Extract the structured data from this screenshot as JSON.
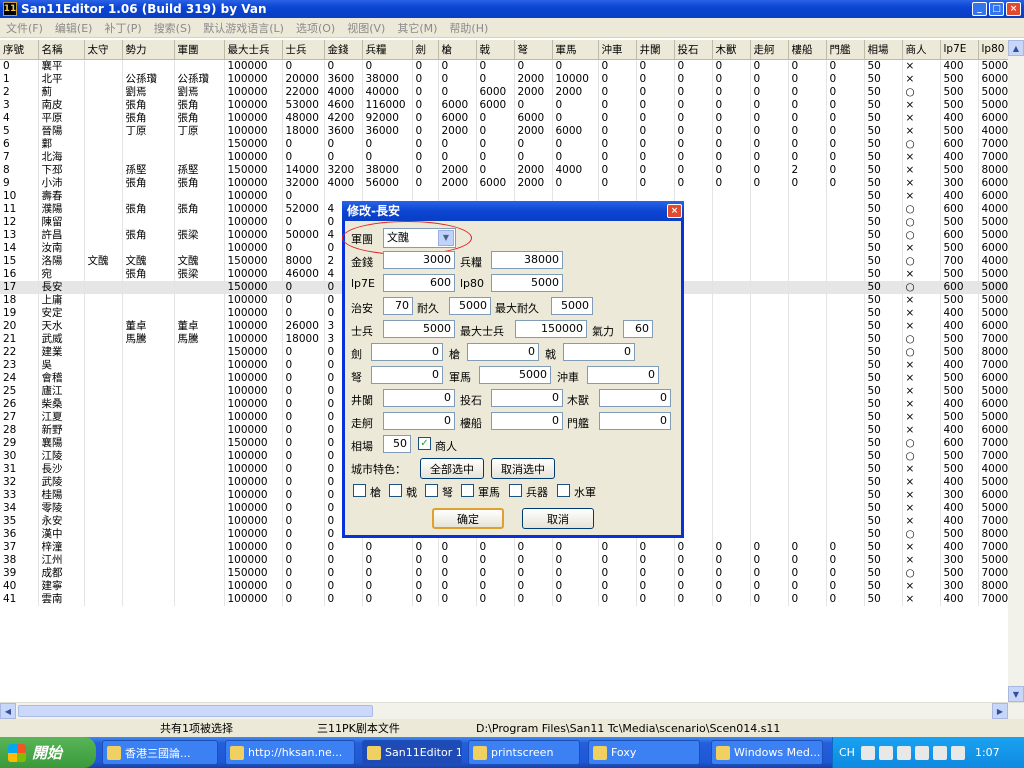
{
  "window": {
    "title": "San11Editor 1.06 (Build 319) by Van",
    "app_icon": "11",
    "min": "_",
    "max": "□",
    "close": "×"
  },
  "menu": [
    "文件(F)",
    "编辑(E)",
    "补丁(P)",
    "搜索(S)",
    "默认游戏语言(L)",
    "选项(O)",
    "视图(V)",
    "其它(M)",
    "帮助(H)"
  ],
  "table": {
    "columns": [
      "序號",
      "名稱",
      "太守",
      "勢力",
      "軍團",
      "最大士兵",
      "士兵",
      "金錢",
      "兵糧",
      "劍",
      "槍",
      "戟",
      "弩",
      "軍馬",
      "沖車",
      "井闌",
      "投石",
      "木獸",
      "走舸",
      "樓船",
      "門艦",
      "相場",
      "商人",
      "lp7E",
      "lp80"
    ],
    "selected_row": 17,
    "rows": [
      [
        "0",
        "襄平",
        "",
        "",
        "",
        "100000",
        "0",
        "0",
        "0",
        "0",
        "0",
        "0",
        "0",
        "0",
        "0",
        "0",
        "0",
        "0",
        "0",
        "0",
        "0",
        "50",
        "×",
        "400",
        "5000"
      ],
      [
        "1",
        "北平",
        "",
        "公孫瓚",
        "公孫瓚",
        "100000",
        "20000",
        "3600",
        "38000",
        "0",
        "0",
        "0",
        "2000",
        "10000",
        "0",
        "0",
        "0",
        "0",
        "0",
        "0",
        "0",
        "50",
        "×",
        "500",
        "6000"
      ],
      [
        "2",
        "薊",
        "",
        "劉焉",
        "劉焉",
        "100000",
        "22000",
        "4000",
        "40000",
        "0",
        "0",
        "6000",
        "2000",
        "2000",
        "0",
        "0",
        "0",
        "0",
        "0",
        "0",
        "0",
        "50",
        "○",
        "500",
        "5000"
      ],
      [
        "3",
        "南皮",
        "",
        "張角",
        "張角",
        "100000",
        "53000",
        "4600",
        "116000",
        "0",
        "6000",
        "6000",
        "0",
        "0",
        "0",
        "0",
        "0",
        "0",
        "0",
        "0",
        "0",
        "50",
        "×",
        "500",
        "5000"
      ],
      [
        "4",
        "平原",
        "",
        "張角",
        "張角",
        "100000",
        "48000",
        "4200",
        "92000",
        "0",
        "6000",
        "0",
        "6000",
        "0",
        "0",
        "0",
        "0",
        "0",
        "0",
        "0",
        "0",
        "50",
        "×",
        "400",
        "6000"
      ],
      [
        "5",
        "晉陽",
        "",
        "丁原",
        "丁原",
        "100000",
        "18000",
        "3600",
        "36000",
        "0",
        "2000",
        "0",
        "2000",
        "6000",
        "0",
        "0",
        "0",
        "0",
        "0",
        "0",
        "0",
        "50",
        "×",
        "500",
        "4000"
      ],
      [
        "6",
        "鄴",
        "",
        "",
        "",
        "150000",
        "0",
        "0",
        "0",
        "0",
        "0",
        "0",
        "0",
        "0",
        "0",
        "0",
        "0",
        "0",
        "0",
        "0",
        "0",
        "50",
        "○",
        "600",
        "7000"
      ],
      [
        "7",
        "北海",
        "",
        "",
        "",
        "100000",
        "0",
        "0",
        "0",
        "0",
        "0",
        "0",
        "0",
        "0",
        "0",
        "0",
        "0",
        "0",
        "0",
        "0",
        "0",
        "50",
        "×",
        "400",
        "7000"
      ],
      [
        "8",
        "下邳",
        "",
        "孫堅",
        "孫堅",
        "150000",
        "14000",
        "3200",
        "38000",
        "0",
        "2000",
        "0",
        "2000",
        "4000",
        "0",
        "0",
        "0",
        "0",
        "0",
        "2",
        "0",
        "50",
        "×",
        "500",
        "8000"
      ],
      [
        "9",
        "小沛",
        "",
        "張角",
        "張角",
        "100000",
        "32000",
        "4000",
        "56000",
        "0",
        "2000",
        "6000",
        "2000",
        "0",
        "0",
        "0",
        "0",
        "0",
        "0",
        "0",
        "0",
        "50",
        "×",
        "300",
        "6000"
      ],
      [
        "10",
        "壽春",
        "",
        "",
        "",
        "100000",
        "0",
        "",
        "",
        "",
        "",
        "",
        "",
        "",
        "",
        "",
        "",
        "",
        "",
        "",
        "",
        "50",
        "×",
        "400",
        "6000"
      ],
      [
        "11",
        "濮陽",
        "",
        "張角",
        "張角",
        "100000",
        "52000",
        "4",
        "",
        "",
        "",
        "",
        "",
        "",
        "",
        "",
        "",
        "",
        "",
        "",
        "",
        "50",
        "○",
        "600",
        "4000"
      ],
      [
        "12",
        "陳留",
        "",
        "",
        "",
        "100000",
        "0",
        "0",
        "",
        "",
        "",
        "",
        "",
        "",
        "",
        "",
        "",
        "",
        "",
        "",
        "",
        "50",
        "○",
        "500",
        "5000"
      ],
      [
        "13",
        "許昌",
        "",
        "張角",
        "張梁",
        "100000",
        "50000",
        "4",
        "",
        "",
        "",
        "",
        "",
        "",
        "",
        "",
        "",
        "",
        "",
        "",
        "",
        "50",
        "○",
        "600",
        "5000"
      ],
      [
        "14",
        "汝南",
        "",
        "",
        "",
        "100000",
        "0",
        "0",
        "",
        "",
        "",
        "",
        "",
        "",
        "",
        "",
        "",
        "",
        "",
        "",
        "",
        "50",
        "×",
        "500",
        "6000"
      ],
      [
        "15",
        "洛陽",
        "文醜",
        "文醜",
        "文醜",
        "150000",
        "8000",
        "2",
        "",
        "",
        "",
        "",
        "",
        "",
        "",
        "",
        "",
        "",
        "",
        "",
        "",
        "50",
        "○",
        "700",
        "4000"
      ],
      [
        "16",
        "宛",
        "",
        "張角",
        "張梁",
        "100000",
        "46000",
        "4",
        "",
        "",
        "",
        "",
        "",
        "",
        "",
        "",
        "",
        "",
        "",
        "",
        "",
        "50",
        "×",
        "500",
        "5000"
      ],
      [
        "17",
        "長安",
        "",
        "",
        "",
        "150000",
        "0",
        "0",
        "",
        "",
        "",
        "",
        "",
        "",
        "",
        "",
        "",
        "",
        "",
        "",
        "",
        "50",
        "○",
        "600",
        "5000"
      ],
      [
        "18",
        "上庸",
        "",
        "",
        "",
        "100000",
        "0",
        "0",
        "",
        "",
        "",
        "",
        "",
        "",
        "",
        "",
        "",
        "",
        "",
        "",
        "",
        "50",
        "×",
        "500",
        "5000"
      ],
      [
        "19",
        "安定",
        "",
        "",
        "",
        "100000",
        "0",
        "0",
        "",
        "",
        "",
        "",
        "",
        "",
        "",
        "",
        "",
        "",
        "",
        "",
        "",
        "50",
        "×",
        "400",
        "5000"
      ],
      [
        "20",
        "天水",
        "",
        "董卓",
        "董卓",
        "100000",
        "26000",
        "3",
        "",
        "",
        "",
        "",
        "",
        "",
        "",
        "",
        "",
        "",
        "",
        "",
        "",
        "50",
        "×",
        "400",
        "6000"
      ],
      [
        "21",
        "武威",
        "",
        "馬騰",
        "馬騰",
        "100000",
        "18000",
        "3",
        "",
        "",
        "",
        "",
        "",
        "",
        "",
        "",
        "",
        "",
        "",
        "",
        "",
        "50",
        "○",
        "500",
        "7000"
      ],
      [
        "22",
        "建業",
        "",
        "",
        "",
        "150000",
        "0",
        "0",
        "",
        "",
        "",
        "",
        "",
        "",
        "",
        "",
        "",
        "",
        "",
        "",
        "",
        "50",
        "○",
        "500",
        "8000"
      ],
      [
        "23",
        "吳",
        "",
        "",
        "",
        "100000",
        "0",
        "0",
        "",
        "",
        "",
        "",
        "",
        "",
        "",
        "",
        "",
        "",
        "",
        "",
        "",
        "50",
        "×",
        "400",
        "7000"
      ],
      [
        "24",
        "會稽",
        "",
        "",
        "",
        "100000",
        "0",
        "0",
        "",
        "",
        "",
        "",
        "",
        "",
        "",
        "",
        "",
        "",
        "",
        "",
        "",
        "50",
        "×",
        "500",
        "6000"
      ],
      [
        "25",
        "廬江",
        "",
        "",
        "",
        "100000",
        "0",
        "0",
        "",
        "",
        "",
        "",
        "",
        "",
        "",
        "",
        "",
        "",
        "",
        "",
        "",
        "50",
        "×",
        "500",
        "5000"
      ],
      [
        "26",
        "柴桑",
        "",
        "",
        "",
        "100000",
        "0",
        "0",
        "",
        "",
        "",
        "",
        "",
        "",
        "",
        "",
        "",
        "",
        "",
        "",
        "",
        "50",
        "×",
        "400",
        "6000"
      ],
      [
        "27",
        "江夏",
        "",
        "",
        "",
        "100000",
        "0",
        "0",
        "",
        "",
        "",
        "",
        "",
        "",
        "",
        "",
        "",
        "",
        "",
        "",
        "",
        "50",
        "×",
        "500",
        "5000"
      ],
      [
        "28",
        "新野",
        "",
        "",
        "",
        "100000",
        "0",
        "0",
        "",
        "",
        "",
        "",
        "",
        "",
        "",
        "",
        "",
        "",
        "",
        "",
        "",
        "50",
        "×",
        "400",
        "6000"
      ],
      [
        "29",
        "襄陽",
        "",
        "",
        "",
        "150000",
        "0",
        "0",
        "",
        "",
        "",
        "",
        "",
        "",
        "",
        "",
        "",
        "",
        "",
        "",
        "",
        "50",
        "○",
        "600",
        "7000"
      ],
      [
        "30",
        "江陵",
        "",
        "",
        "",
        "100000",
        "0",
        "0",
        "",
        "",
        "",
        "",
        "",
        "",
        "",
        "",
        "",
        "",
        "",
        "",
        "",
        "50",
        "○",
        "500",
        "7000"
      ],
      [
        "31",
        "長沙",
        "",
        "",
        "",
        "100000",
        "0",
        "0",
        "",
        "",
        "",
        "",
        "",
        "",
        "",
        "",
        "",
        "",
        "",
        "",
        "",
        "50",
        "×",
        "500",
        "4000"
      ],
      [
        "32",
        "武陵",
        "",
        "",
        "",
        "100000",
        "0",
        "0",
        "",
        "",
        "",
        "",
        "",
        "",
        "",
        "",
        "",
        "",
        "",
        "",
        "",
        "50",
        "×",
        "400",
        "5000"
      ],
      [
        "33",
        "桂陽",
        "",
        "",
        "",
        "100000",
        "0",
        "0",
        "",
        "",
        "",
        "",
        "",
        "",
        "",
        "",
        "",
        "",
        "",
        "",
        "",
        "50",
        "×",
        "300",
        "6000"
      ],
      [
        "34",
        "零陵",
        "",
        "",
        "",
        "100000",
        "0",
        "0",
        "",
        "",
        "",
        "",
        "",
        "",
        "",
        "",
        "",
        "",
        "",
        "",
        "",
        "50",
        "×",
        "400",
        "5000"
      ],
      [
        "35",
        "永安",
        "",
        "",
        "",
        "100000",
        "0",
        "0",
        "",
        "",
        "",
        "",
        "",
        "",
        "",
        "",
        "",
        "",
        "",
        "",
        "",
        "50",
        "×",
        "400",
        "7000"
      ],
      [
        "36",
        "漢中",
        "",
        "",
        "",
        "100000",
        "0",
        "0",
        "",
        "",
        "",
        "",
        "",
        "",
        "",
        "",
        "",
        "",
        "",
        "",
        "",
        "50",
        "○",
        "500",
        "8000"
      ],
      [
        "37",
        "梓潼",
        "",
        "",
        "",
        "100000",
        "0",
        "0",
        "0",
        "0",
        "0",
        "0",
        "0",
        "0",
        "0",
        "0",
        "0",
        "0",
        "0",
        "0",
        "0",
        "50",
        "×",
        "400",
        "7000"
      ],
      [
        "38",
        "江州",
        "",
        "",
        "",
        "100000",
        "0",
        "0",
        "0",
        "0",
        "0",
        "0",
        "0",
        "0",
        "0",
        "0",
        "0",
        "0",
        "0",
        "0",
        "0",
        "50",
        "×",
        "300",
        "5000"
      ],
      [
        "39",
        "成都",
        "",
        "",
        "",
        "150000",
        "0",
        "0",
        "0",
        "0",
        "0",
        "0",
        "0",
        "0",
        "0",
        "0",
        "0",
        "0",
        "0",
        "0",
        "0",
        "50",
        "○",
        "500",
        "7000"
      ],
      [
        "40",
        "建寧",
        "",
        "",
        "",
        "100000",
        "0",
        "0",
        "0",
        "0",
        "0",
        "0",
        "0",
        "0",
        "0",
        "0",
        "0",
        "0",
        "0",
        "0",
        "0",
        "50",
        "×",
        "300",
        "8000"
      ],
      [
        "41",
        "雲南",
        "",
        "",
        "",
        "100000",
        "0",
        "0",
        "0",
        "0",
        "0",
        "0",
        "0",
        "0",
        "0",
        "0",
        "0",
        "0",
        "0",
        "0",
        "0",
        "50",
        "×",
        "400",
        "7000"
      ]
    ]
  },
  "dialog": {
    "title": "修改-長安",
    "close": "×",
    "legion_label": "軍團",
    "legion_value": "文醜",
    "gold_label": "金錢",
    "gold": "3000",
    "food_label": "兵糧",
    "food": "38000",
    "lp7e_label": "lp7E",
    "lp7e": "600",
    "lp80_label": "lp80",
    "lp80": "5000",
    "order_label": "治安",
    "order": "70",
    "dur_label": "耐久",
    "dur": "5000",
    "maxdur_label": "最大耐久",
    "maxdur": "5000",
    "troops_label": "士兵",
    "troops": "5000",
    "maxtroops_label": "最大士兵",
    "maxtroops": "150000",
    "energy_label": "氣力",
    "energy": "60",
    "sword_label": "劍",
    "sword": "0",
    "spear_label": "槍",
    "spear": "0",
    "halberd_label": "戟",
    "halberd": "0",
    "bow_label": "弩",
    "bow": "0",
    "horse_label": "軍馬",
    "horse": "5000",
    "ram_label": "沖車",
    "ram": "0",
    "tower_label": "井闌",
    "tower": "0",
    "catapult_label": "投石",
    "catapult": "0",
    "wood_label": "木獸",
    "wood": "0",
    "boat_label": "走舸",
    "boat": "0",
    "warship_label": "樓船",
    "warship": "0",
    "gunboat_label": "門艦",
    "gunboat": "0",
    "market_label": "相場",
    "market": "50",
    "merchant_label": "商人",
    "features_label": "城市特色：",
    "select_all": "全部选中",
    "deselect_all": "取消选中",
    "features": [
      "槍",
      "戟",
      "弩",
      "軍馬",
      "兵器",
      "水軍"
    ],
    "ok": "确定",
    "cancel": "取消"
  },
  "status": {
    "selected": "共有1项被选择",
    "type": "三11PK剧本文件",
    "path": "D:\\Program Files\\San11 Tc\\Media\\scenario\\Scen014.s11"
  },
  "taskbar": {
    "start": "開始",
    "tasks": [
      "香港三國論...",
      "http://hksan.ne...",
      "San11Editor 1...",
      "printscreen",
      "Foxy",
      "Windows Med..."
    ],
    "lang": "CH",
    "clock": "1:07"
  }
}
